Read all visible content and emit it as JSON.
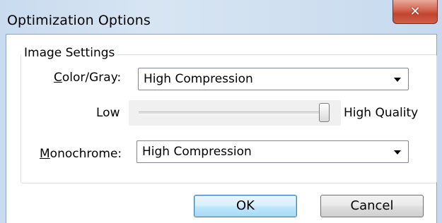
{
  "window": {
    "title": "Optimization Options",
    "close_icon": "close-x-icon"
  },
  "image_settings": {
    "group_label": "Image Settings",
    "color_gray": {
      "label_mnemonic": "C",
      "label_rest": "olor/Gray:",
      "selected": "High Compression"
    },
    "quality_slider": {
      "low_label": "Low",
      "high_label": "High Quality",
      "level_fraction": 1.0
    },
    "monochrome": {
      "label_mnemonic": "M",
      "label_rest": "onochrome:",
      "selected": "High Compression"
    }
  },
  "buttons": {
    "ok": "OK",
    "cancel": "Cancel"
  }
}
